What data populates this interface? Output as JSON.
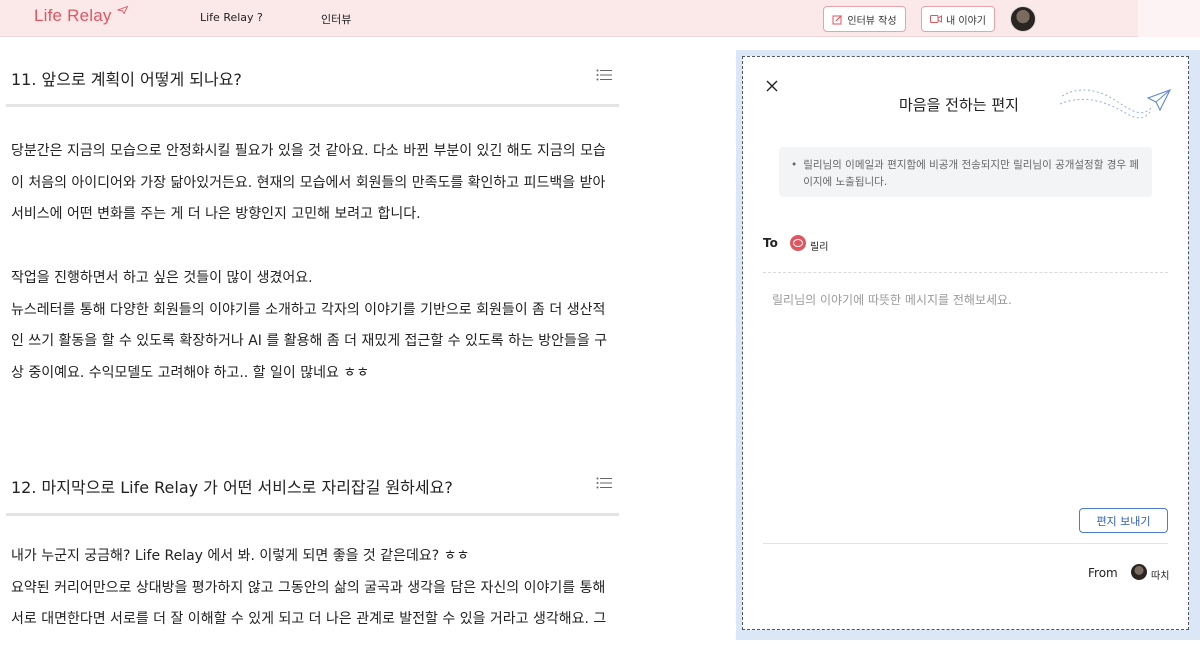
{
  "header": {
    "logo": "Life Relay",
    "nav": [
      "Life Relay ?",
      "인터뷰"
    ],
    "write_button": "인터뷰 작성",
    "story_button": "내 이야기"
  },
  "article": {
    "q11_title": "11. 앞으로 계획이 어떻게 되나요?",
    "q11_para1": "당분간은 지금의 모습으로 안정화시킬 필요가 있을 것 같아요. 다소 바뀐 부분이 있긴 해도 지금의 모습\n이 처음의 아이디어와 가장 닮아있거든요. 현재의 모습에서 회원들의 만족도를 확인하고 피드백을 받아\n서비스에 어떤 변화를 주는 게 더 나은 방향인지 고민해 보려고 합니다.",
    "q11_para2": "작업을 진행하면서 하고 싶은 것들이 많이 생겼어요.\n뉴스레터를 통해 다양한 회원들의 이야기를 소개하고 각자의 이야기를 기반으로 회원들이 좀 더 생산적\n인 쓰기 활동을 할 수 있도록 확장하거나 AI 를 활용해 좀 더 재밌게 접근할 수 있도록 하는 방안들을 구\n상 중이예요. 수익모델도 고려해야 하고.. 할 일이 많네요 ㅎㅎ",
    "q12_title": "12. 마지막으로 Life Relay 가 어떤 서비스로 자리잡길 원하세요?",
    "q12_para": "내가 누군지 궁금해? Life Relay 에서 봐. 이렇게 되면 좋을 것 같은데요? ㅎㅎ\n요약된 커리어만으로 상대방을 평가하지 않고 그동안의 삶의 굴곡과 생각을 담은 자신의 이야기를 통해\n서로 대면한다면 서로를 더 잘 이해할 수 있게 되고 더 나은 관계로 발전할 수 있을 거라고 생각해요. 그"
  },
  "letter": {
    "title": "마음을 전하는 편지",
    "notice": "릴리님의 이메일과 편지함에 비공개 전송되지만 릴리님이 공개설정할 경우 페이지에 노출됩니다.",
    "to_label": "To",
    "to_name": "릴리",
    "placeholder": "릴리님의 이야기에 따뜻한 메시지를 전해보세요.",
    "send_button": "편지 보내기",
    "from_label": "From",
    "from_name": "따치"
  },
  "colors": {
    "header_bg": "#fbe9ea",
    "brand": "#e2555f",
    "panel_outline": "#dbe6f7",
    "send_accent": "#4d7bd1"
  },
  "icons": [
    "paper-plane-logo-icon",
    "pencil-icon",
    "video-icon",
    "list-icon",
    "close-icon",
    "paper-plane-icon"
  ]
}
